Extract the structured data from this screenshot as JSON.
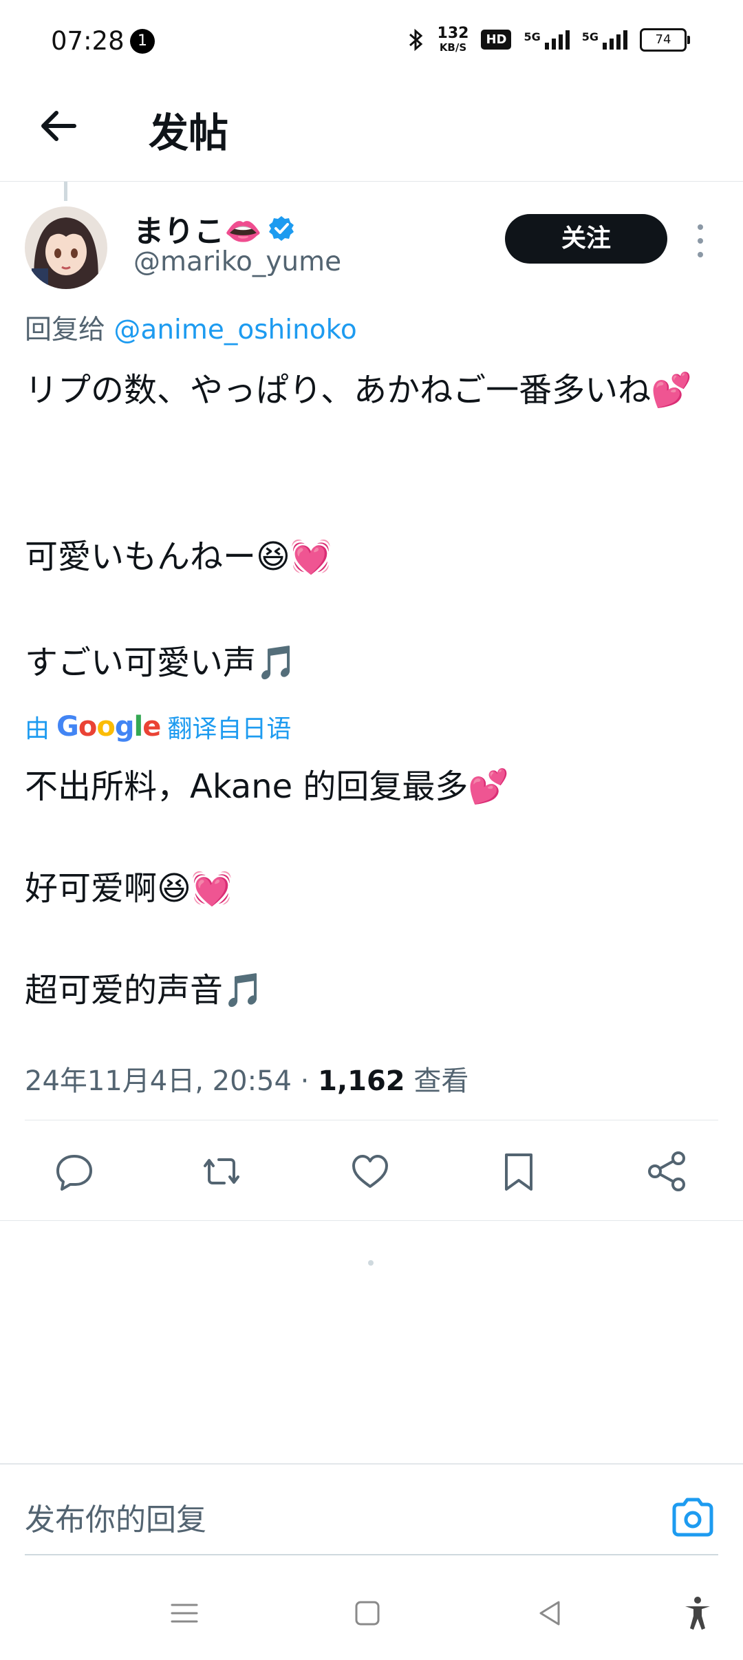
{
  "status_bar": {
    "time": "07:28",
    "notification_count": "1",
    "network_speed_value": "132",
    "network_speed_unit": "KB/S",
    "hd_label": "HD",
    "signal_1_label": "5G",
    "signal_2_label": "5G",
    "battery_level": "74"
  },
  "header": {
    "title": "发帖"
  },
  "post": {
    "author_name": "まりこ👄",
    "author_handle": "@mariko_yume",
    "follow_label": "关注",
    "reply_prefix": "回复给",
    "reply_to_handle": "@anime_oshinoko",
    "original_lines": [
      "リプの数、やっぱり、あかねご一番多いね💕",
      "可愛いもんねー😆💓",
      "すごい可愛い声🎵"
    ],
    "translate_prefix": "由",
    "translate_google": "Google",
    "translate_suffix": "翻译自日语",
    "translated_lines": [
      "不出所料，Akane 的回复最多💕",
      "好可爱啊😆💓",
      "超可爱的声音🎵"
    ],
    "timestamp": "24年11月4日, 20:54",
    "separator": "·",
    "view_count": "1,162",
    "views_label": "查看"
  },
  "reply_bar": {
    "placeholder": "发布你的回复"
  },
  "colors": {
    "accent": "#1d9bf0",
    "text": "#0f1419",
    "secondary": "#536471"
  }
}
